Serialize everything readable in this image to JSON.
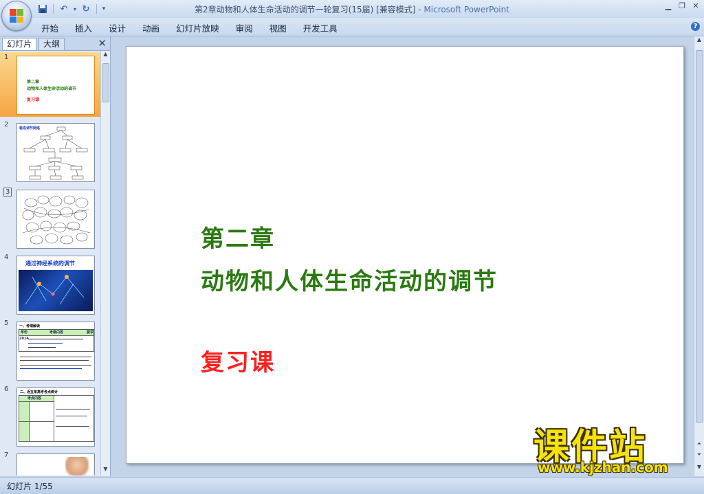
{
  "window": {
    "title": "第2章动物和人体生命活动的调节一轮复习(15届) [兼容模式]",
    "title_sep": " - ",
    "app_name": "Microsoft PowerPoint"
  },
  "qat": {
    "save_icon": "save-icon",
    "undo_icon": "undo-icon",
    "redo_icon": "redo-icon"
  },
  "ribbon": {
    "tabs": [
      "开始",
      "插入",
      "设计",
      "动画",
      "幻灯片放映",
      "审阅",
      "视图",
      "开发工具"
    ]
  },
  "panel": {
    "tabs": [
      "幻灯片",
      "大纲"
    ],
    "close_glyph": "✕",
    "thumbnails": [
      {
        "number": "1",
        "selected": true,
        "lines": [
          "第二章",
          "动物和人体生命活动的调节",
          "复习课"
        ]
      },
      {
        "number": "2",
        "title": "稳态调节网络"
      },
      {
        "number": "3"
      },
      {
        "number": "4",
        "title": "通过神经系统的调节"
      },
      {
        "number": "5",
        "title": "一、考纲解读",
        "header_cells": [
          "年份",
          "考纲内容",
          "要求"
        ],
        "year": "2014"
      },
      {
        "number": "6",
        "title": "二、近五年高考考点统计",
        "col_head": "考点内容"
      },
      {
        "number": "7"
      }
    ]
  },
  "slide": {
    "title_line1": "第二章",
    "title_line2": "动物和人体生命活动的调节",
    "subtitle": "复习课",
    "colors": {
      "title": "#2a7a10",
      "subtitle": "#ff1f1f"
    }
  },
  "watermark": {
    "big": "课件站",
    "url": "www.kjzhan.com"
  },
  "status": {
    "text": "幻灯片 1/55"
  }
}
